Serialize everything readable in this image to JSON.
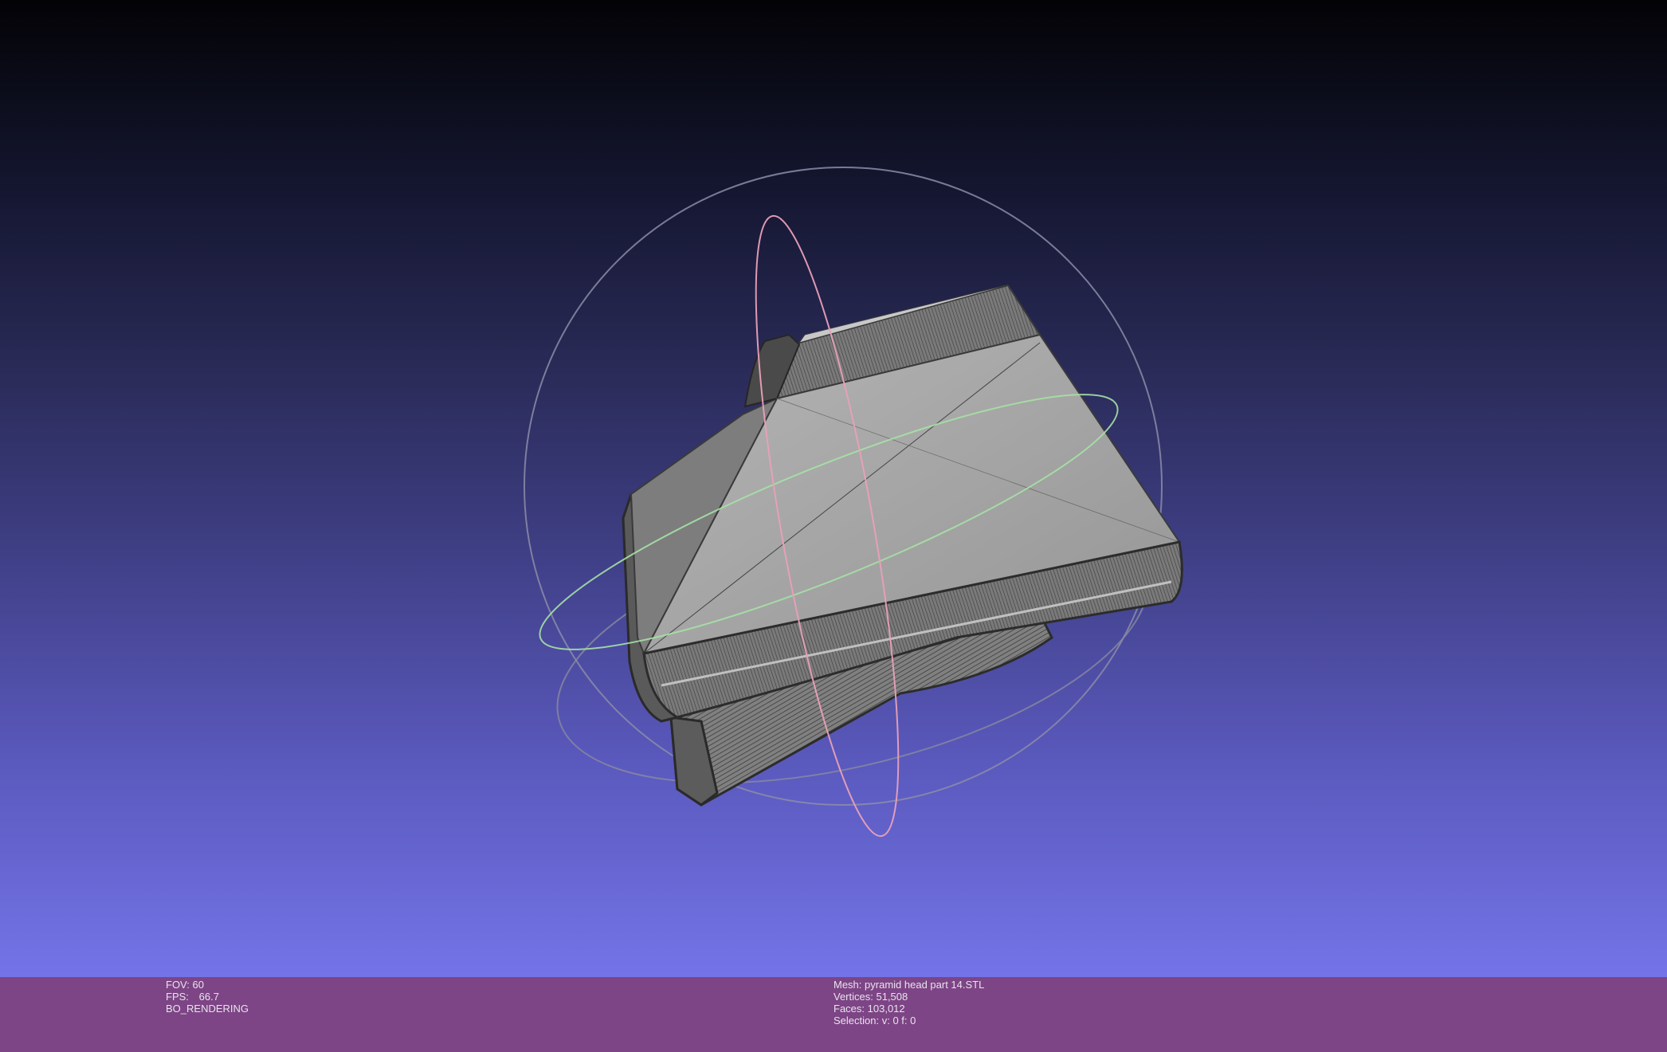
{
  "viewer": {
    "background_top": "#030306",
    "background_bottom": "#7474e8",
    "mesh_color": "#a6a6a6",
    "trackball": {
      "sphere_color": "#8c8ca8",
      "axis_x_color": "#e9a0b8",
      "axis_y_color": "#a6e0a6",
      "axis_z_color": "#8c8ca8"
    }
  },
  "status": {
    "left": {
      "fov_label": "FOV:",
      "fov_value": "60",
      "fps_label": "FPS:",
      "fps_value": "66.7",
      "render_mode": "BO_RENDERING"
    },
    "right": {
      "mesh_label": "Mesh:",
      "mesh_value": "pyramid head part 14.STL",
      "vertices_label": "Vertices:",
      "vertices_value": "51,508",
      "faces_label": "Faces:",
      "faces_value": "103,012",
      "selection_label": "Selection:",
      "selection_value": "v: 0 f: 0"
    }
  },
  "bar_color": "#7d4585"
}
